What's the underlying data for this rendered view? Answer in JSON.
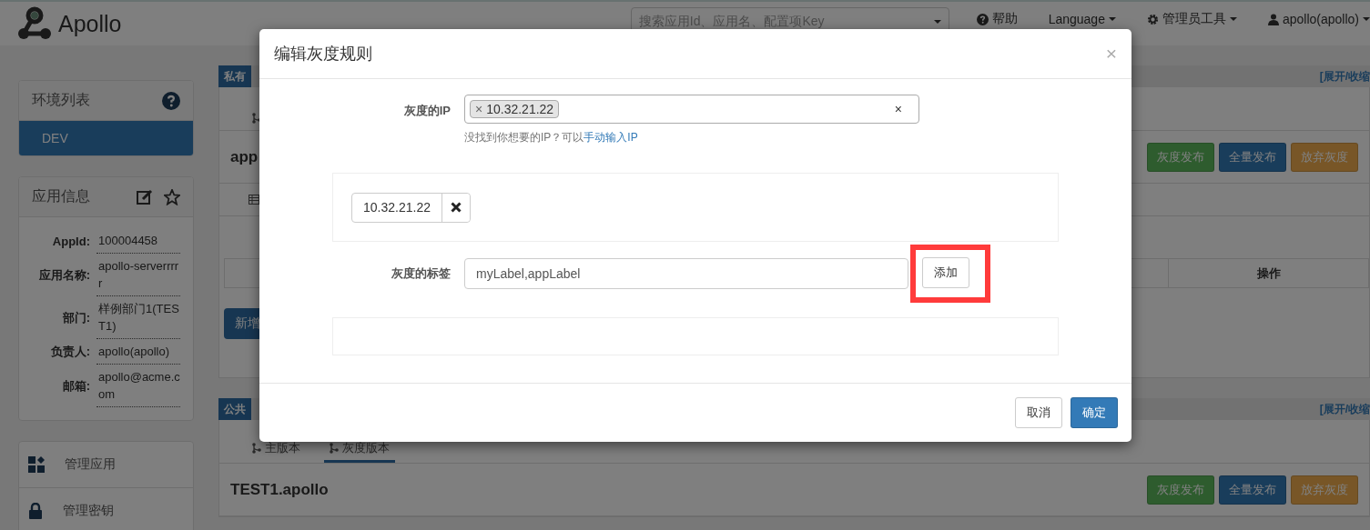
{
  "header": {
    "logo": "Apollo",
    "search": {
      "placeholder": "搜索应用Id、应用名、配置项Key"
    },
    "nav": [
      {
        "kind": "help",
        "label": "帮助"
      },
      {
        "kind": "menu",
        "label": "Language"
      },
      {
        "kind": "admin",
        "label": "管理员工具"
      },
      {
        "kind": "user",
        "label": "apollo(apollo)"
      }
    ]
  },
  "sidebar": {
    "env_panel": {
      "title": "环境列表",
      "envs": [
        {
          "label": "DEV",
          "selected": true
        }
      ]
    },
    "app_info": {
      "title": "应用信息",
      "fields": [
        {
          "label": "AppId:",
          "value": "100004458"
        },
        {
          "label": "应用名称:",
          "value": "apollo-serverrrrr"
        },
        {
          "label": "部门:",
          "value": "样例部门1(TEST1)"
        },
        {
          "label": "负责人:",
          "value": "apollo(apollo)"
        },
        {
          "label": "邮箱:",
          "value": "apollo@acme.com"
        }
      ]
    },
    "menu": [
      {
        "kind": "apps",
        "label": "管理应用"
      },
      {
        "kind": "lock",
        "label": "管理密钥"
      }
    ]
  },
  "namespaces": [
    {
      "badge": "私有",
      "toggle": "[展开/收缩",
      "title": "app",
      "buttons": [
        {
          "kind": "success",
          "label": "灰度发布"
        },
        {
          "kind": "primary",
          "label": "全量发布"
        },
        {
          "kind": "warning",
          "label": "放弃灰度"
        }
      ],
      "table_header": "操作",
      "add_button": "新增"
    },
    {
      "badge": "公共",
      "toggle": "[展开/收缩",
      "tabs": [
        {
          "label": "主版本",
          "selected": false
        },
        {
          "label": "灰度版本",
          "selected": true
        }
      ],
      "title": "TEST1.apollo",
      "buttons": [
        {
          "kind": "success",
          "label": "灰度发布"
        },
        {
          "kind": "primary",
          "label": "全量发布"
        },
        {
          "kind": "warning",
          "label": "放弃灰度"
        }
      ]
    }
  ],
  "modal": {
    "title": "编辑灰度规则",
    "close": "×",
    "ip_field": {
      "label": "灰度的IP",
      "chips": [
        {
          "remove": "×",
          "label": "10.32.21.22"
        }
      ],
      "clear": "×",
      "help_text": "没找到你想要的IP？可以",
      "help_link": "手动输入IP"
    },
    "ip_list": [
      {
        "label": "10.32.21.22"
      }
    ],
    "label_field": {
      "label": "灰度的标签",
      "value": "myLabel,appLabel",
      "add_button": "添加",
      "highlighted": true
    },
    "footer_buttons": [
      {
        "kind": "default",
        "label": "取消"
      },
      {
        "kind": "primary",
        "label": "确定"
      }
    ]
  }
}
